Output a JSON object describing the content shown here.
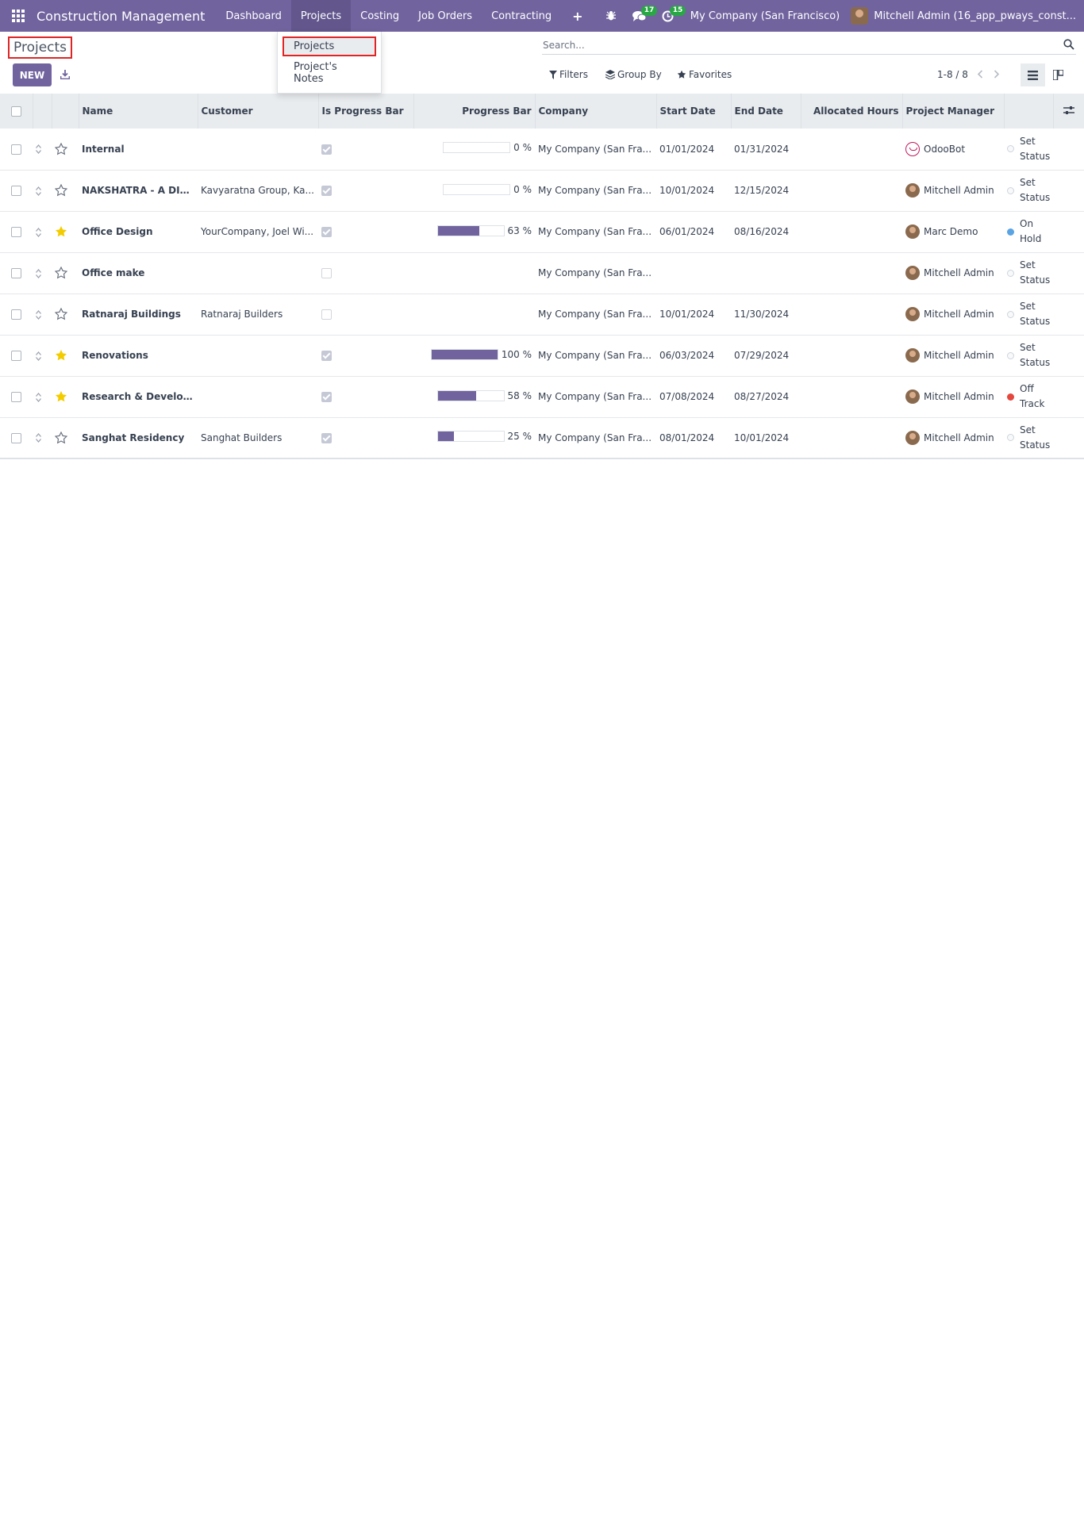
{
  "navbar": {
    "brand": "Construction Management",
    "menu": [
      "Dashboard",
      "Projects",
      "Costing",
      "Job Orders",
      "Contracting"
    ],
    "plus": "+",
    "messages_count": "17",
    "activities_count": "15",
    "company": "My Company (San Francisco)",
    "user": "Mitchell Admin (16_app_pways_const..."
  },
  "dropdown": {
    "items": [
      "Projects",
      "Project's Notes"
    ]
  },
  "control": {
    "title": "Projects",
    "new_label": "NEW",
    "search_placeholder": "Search...",
    "filters": "Filters",
    "group_by": "Group By",
    "favorites": "Favorites",
    "pager": "1-8 / 8"
  },
  "table": {
    "columns": [
      "Name",
      "Customer",
      "Is Progress Bar",
      "Progress Bar",
      "Company",
      "Start Date",
      "End Date",
      "Allocated Hours",
      "Project Manager"
    ],
    "rows": [
      {
        "favorite": false,
        "name": "Internal",
        "customer": "",
        "is_progress_bar": true,
        "progress": 0,
        "progress_label": "0 %",
        "company": "My Company (San Fra...",
        "start": "01/01/2024",
        "end": "01/31/2024",
        "manager": "OdooBot",
        "manager_avatar": "bot",
        "status_1": "Set",
        "status_2": "Status",
        "status_color": "#f8f9fa"
      },
      {
        "favorite": false,
        "name": "NAKSHATRA - A DISTI...",
        "customer": "Kavyaratna Group, Ka...",
        "is_progress_bar": true,
        "progress": 0,
        "progress_label": "0 %",
        "company": "My Company (San Fra...",
        "start": "10/01/2024",
        "end": "12/15/2024",
        "manager": "Mitchell Admin",
        "manager_avatar": "photo",
        "status_1": "Set",
        "status_2": "Status",
        "status_color": "#f8f9fa"
      },
      {
        "favorite": true,
        "name": "Office Design",
        "customer": "YourCompany, Joel Wi...",
        "is_progress_bar": true,
        "progress": 63,
        "progress_label": "63 %",
        "company": "My Company (San Fra...",
        "start": "06/01/2024",
        "end": "08/16/2024",
        "manager": "Marc Demo",
        "manager_avatar": "photo",
        "status_1": "On",
        "status_2": "Hold",
        "status_color": "#5aa4e4"
      },
      {
        "favorite": false,
        "name": "Office make",
        "customer": "",
        "is_progress_bar": false,
        "progress": null,
        "progress_label": "",
        "company": "My Company (San Fra...",
        "start": "",
        "end": "",
        "manager": "Mitchell Admin",
        "manager_avatar": "photo",
        "status_1": "Set",
        "status_2": "Status",
        "status_color": "#f8f9fa"
      },
      {
        "favorite": false,
        "name": "Ratnaraj Buildings",
        "customer": "Ratnaraj Builders",
        "is_progress_bar": false,
        "progress": null,
        "progress_label": "",
        "company": "My Company (San Fra...",
        "start": "10/01/2024",
        "end": "11/30/2024",
        "manager": "Mitchell Admin",
        "manager_avatar": "photo",
        "status_1": "Set",
        "status_2": "Status",
        "status_color": "#f8f9fa"
      },
      {
        "favorite": true,
        "name": "Renovations",
        "customer": "",
        "is_progress_bar": true,
        "progress": 100,
        "progress_label": "100 %",
        "company": "My Company (San Fra...",
        "start": "06/03/2024",
        "end": "07/29/2024",
        "manager": "Mitchell Admin",
        "manager_avatar": "photo",
        "status_1": "Set",
        "status_2": "Status",
        "status_color": "#f8f9fa"
      },
      {
        "favorite": true,
        "name": "Research & Developm...",
        "customer": "",
        "is_progress_bar": true,
        "progress": 58,
        "progress_label": "58 %",
        "company": "My Company (San Fra...",
        "start": "07/08/2024",
        "end": "08/27/2024",
        "manager": "Mitchell Admin",
        "manager_avatar": "photo",
        "status_1": "Off",
        "status_2": "Track",
        "status_color": "#e4473d"
      },
      {
        "favorite": false,
        "name": "Sanghat Residency",
        "customer": "Sanghat Builders",
        "is_progress_bar": true,
        "progress": 25,
        "progress_label": "25 %",
        "company": "My Company (San Fra...",
        "start": "08/01/2024",
        "end": "10/01/2024",
        "manager": "Mitchell Admin",
        "manager_avatar": "photo",
        "status_1": "Set",
        "status_2": "Status",
        "status_color": "#f8f9fa"
      }
    ]
  },
  "colors": {
    "brand": "#71639e",
    "star_active": "#f3cc00",
    "highlight": "#e02424"
  }
}
